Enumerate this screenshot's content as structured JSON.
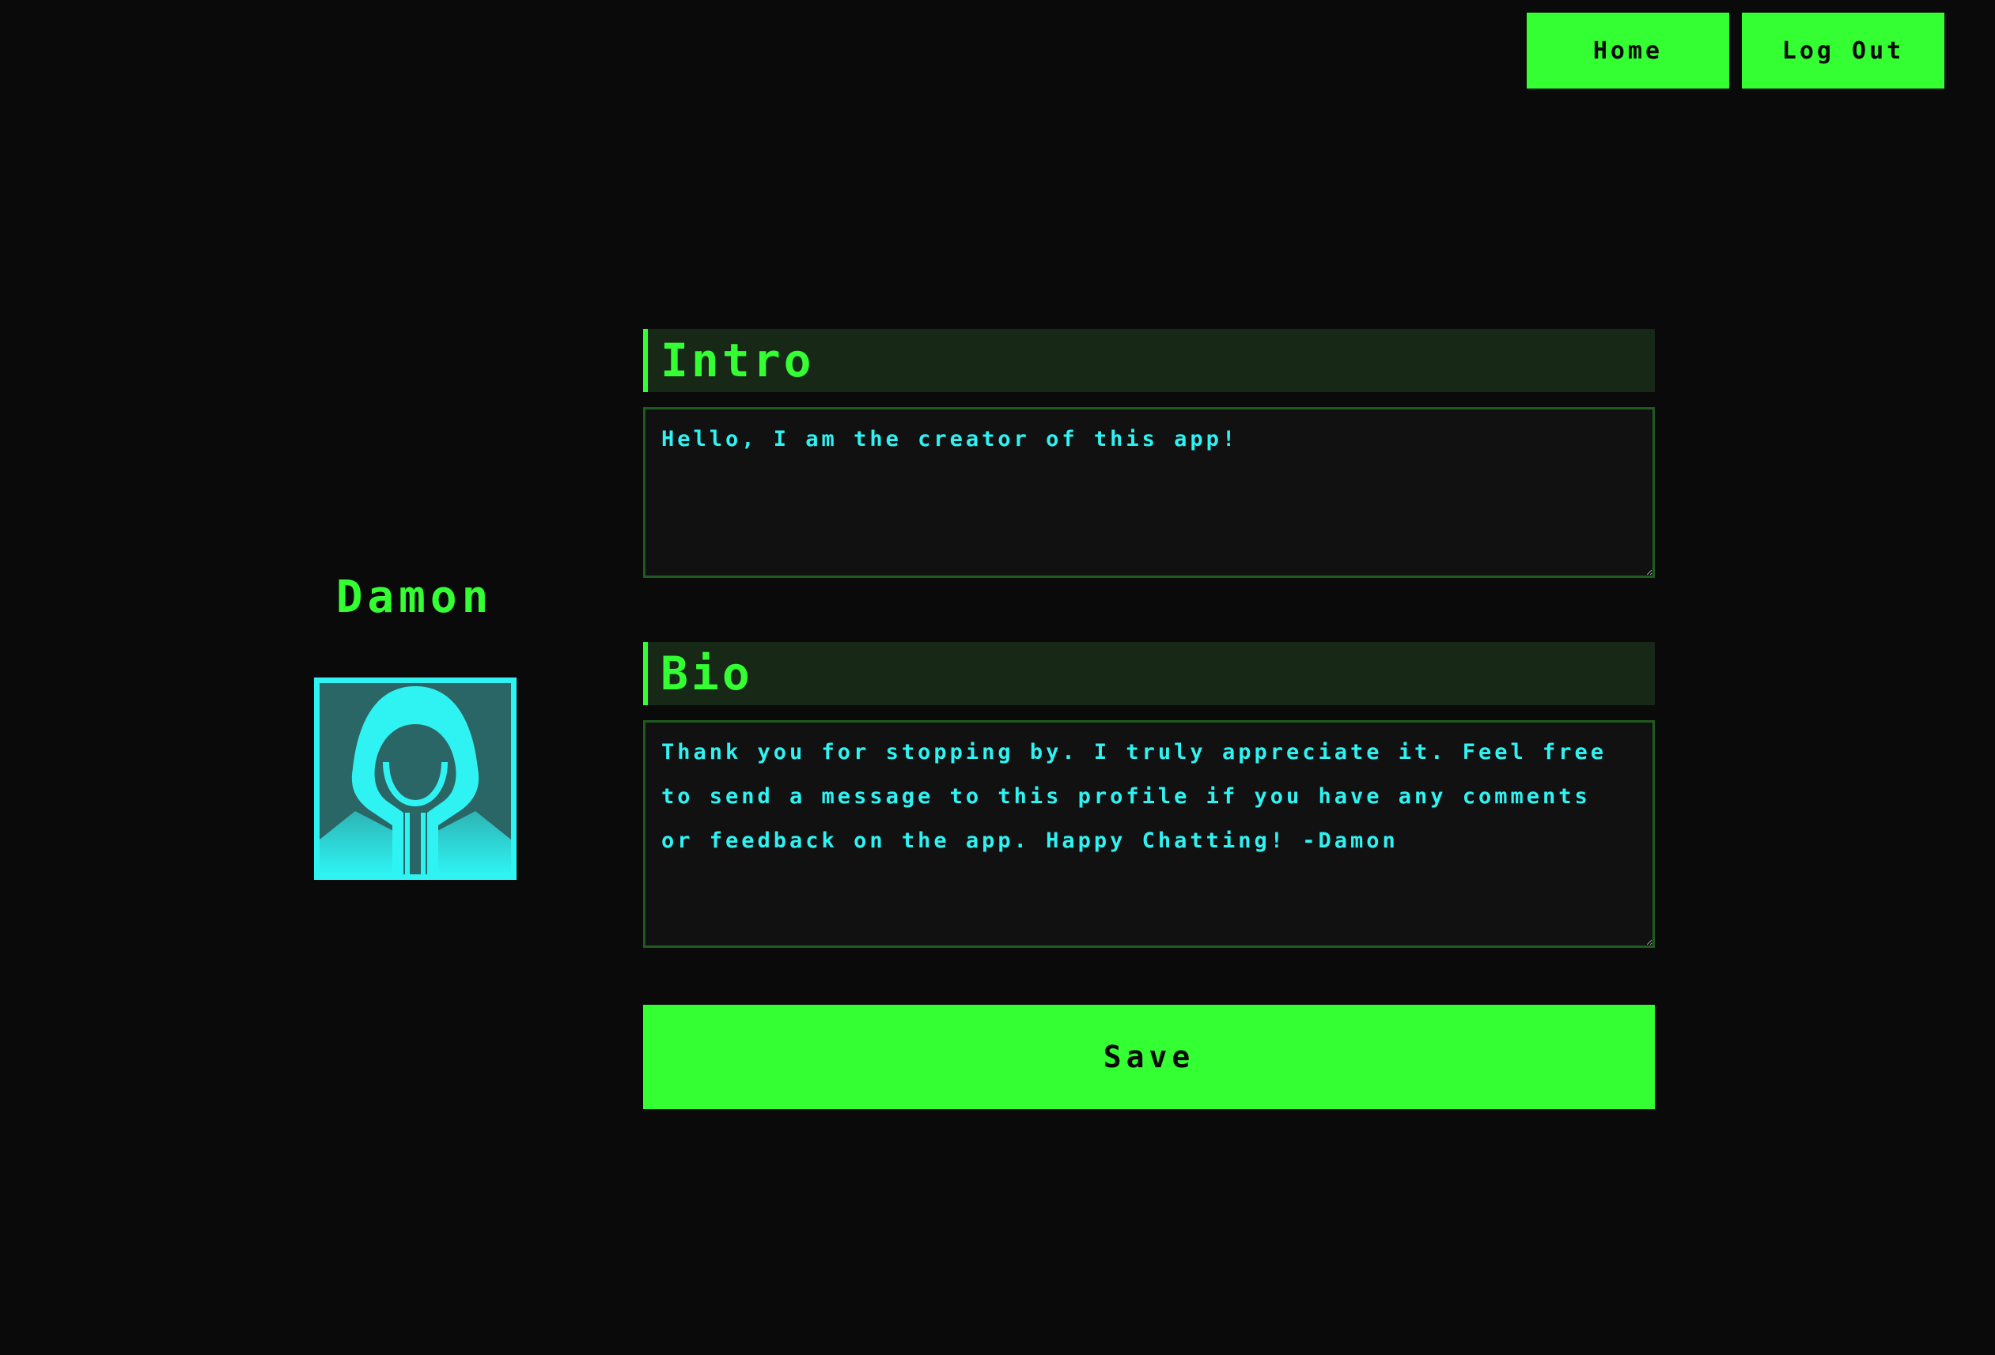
{
  "nav": {
    "home_label": "Home",
    "logout_label": "Log Out"
  },
  "profile": {
    "name": "Damon",
    "avatar_icon": "hooded-figure-icon"
  },
  "intro": {
    "heading": "Intro",
    "value": "Hello, I am the creator of this app!"
  },
  "bio": {
    "heading": "Bio",
    "value": "Thank you for stopping by. I truly appreciate it. Feel free to send a message to this profile if you have any comments or feedback on the app. Happy Chatting! -Damon"
  },
  "actions": {
    "save_label": "Save"
  },
  "colors": {
    "background": "#0a0a0a",
    "accent_green": "#33ff33",
    "accent_cyan": "#2ff3f3",
    "header_bg": "#182817",
    "field_bg": "#111111"
  }
}
